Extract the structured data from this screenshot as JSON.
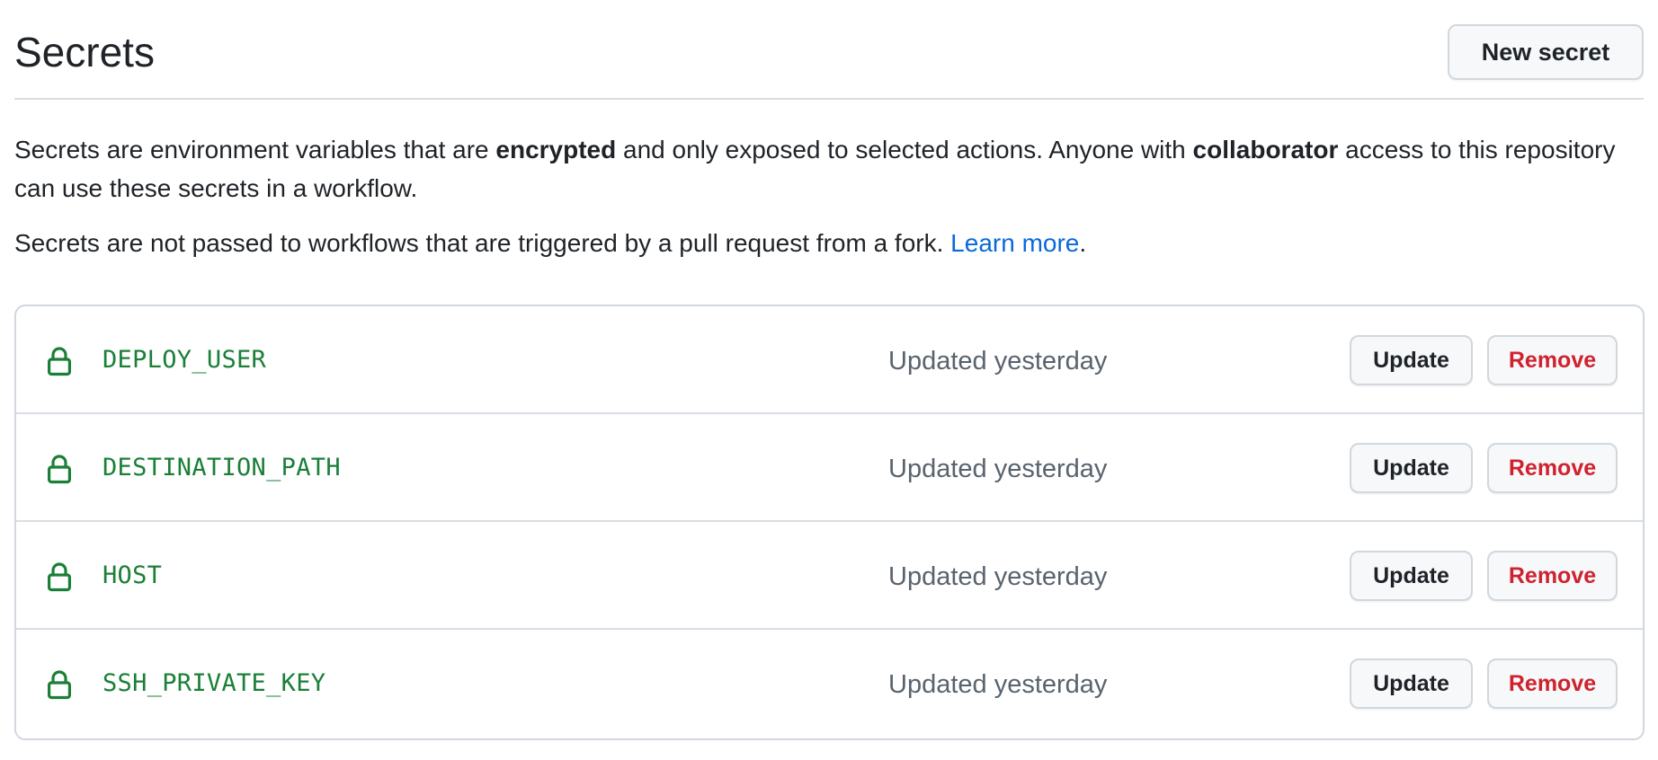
{
  "header": {
    "title": "Secrets",
    "new_secret_label": "New secret"
  },
  "description": {
    "p1_part1": "Secrets are environment variables that are ",
    "p1_bold1": "encrypted",
    "p1_part2": " and only exposed to selected actions. Anyone with ",
    "p1_bold2": "collaborator",
    "p1_part3": " access to this repository can use these secrets in a workflow.",
    "p2_text": "Secrets are not passed to workflows that are triggered by a pull request from a fork. ",
    "p2_link": "Learn more",
    "p2_end": "."
  },
  "secrets": [
    {
      "name": "DEPLOY_USER",
      "updated": "Updated yesterday",
      "update_label": "Update",
      "remove_label": "Remove"
    },
    {
      "name": "DESTINATION_PATH",
      "updated": "Updated yesterday",
      "update_label": "Update",
      "remove_label": "Remove"
    },
    {
      "name": "HOST",
      "updated": "Updated yesterday",
      "update_label": "Update",
      "remove_label": "Remove"
    },
    {
      "name": "SSH_PRIVATE_KEY",
      "updated": "Updated yesterday",
      "update_label": "Update",
      "remove_label": "Remove"
    }
  ],
  "icons": {
    "lock": "lock-icon"
  },
  "colors": {
    "secret_name": "#1a7f37",
    "link": "#0969da",
    "danger": "#cf222e",
    "muted": "#59636e"
  }
}
